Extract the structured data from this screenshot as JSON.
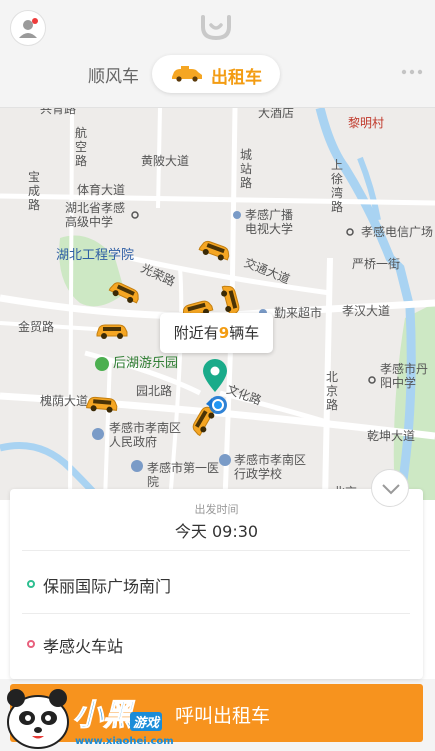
{
  "header": {
    "tabs": [
      {
        "label": "顺风车"
      },
      {
        "label": "出租车",
        "active": true
      }
    ]
  },
  "map": {
    "nearby_prefix": "附近有",
    "nearby_count": "9",
    "nearby_suffix": "辆车",
    "labels": {
      "top_left_cut": "共青路",
      "hangkong_rd": "航空路",
      "huangpi_ave": "黄陂大道",
      "chengzhan_rd": "城站路",
      "dajiudian": "大酒店",
      "limingcun": "黎明村",
      "shangxuwan_rd": "上徐湾路",
      "baocheng_rd": "宝成路",
      "tiyu_ave": "体育大道",
      "hubei_xiaogan_school": "湖北省孝感高级中学",
      "xiaogan_tv_univ": "孝感广播电视大学",
      "xiaogan_telecom_plaza": "孝感电信广场",
      "hubei_eng_univ": "湖北工程学院",
      "yanqiao_st": "严桥一街",
      "guangrong_rd": "光荣路",
      "jiaotong_ave": "交通大道",
      "jinmao_rd": "金贸路",
      "shenglai_mkt": "勤来超市",
      "xiaohan_ave": "孝汉大道",
      "houhu_park": "后湖游乐园",
      "yuanbei_rd": "园北路",
      "wenhua_rd": "文化路",
      "beijing_rd": "北京路",
      "danyang_school": "孝感市丹阳中学",
      "huaiyin_ave": "槐荫大道",
      "xiaonan_gov": "孝感市孝南区人民政府",
      "qiankun_ave": "乾坤大道",
      "first_hospital": "孝感市第一医院",
      "admin_school": "孝感市孝南区行政学校",
      "beiyi_cut": "北京"
    }
  },
  "trip": {
    "time_caption": "出发时间",
    "time_value": "今天 09:30",
    "origin": "保丽国际广场南门",
    "destination": "孝感火车站"
  },
  "call_button": {
    "label": "呼叫出租车"
  },
  "watermark": {
    "title": "小黑",
    "subtitle": "游戏",
    "url": "www.xiaohei.com"
  },
  "colors": {
    "accent": "#f7931e",
    "taxi": "#f5a623",
    "origin_dot": "#2ebf91",
    "dest_dot": "#e8607d",
    "pin": "#1aab8a",
    "water": "#a9d3f2",
    "park": "#cde8c4"
  },
  "icons": [
    "user-icon",
    "didi-logo-icon",
    "taxi-car-icon",
    "more-dots-icon",
    "location-pin-icon",
    "chevron-down-icon"
  ]
}
